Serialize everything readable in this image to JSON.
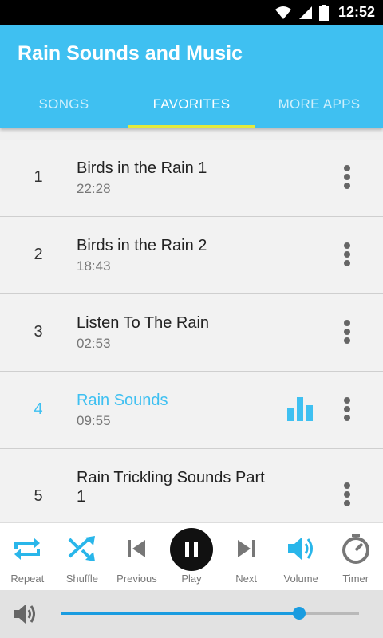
{
  "status_bar": {
    "time": "12:52"
  },
  "app": {
    "title": "Rain Sounds and Music"
  },
  "tabs": [
    {
      "label": "SONGS",
      "active": false
    },
    {
      "label": "FAVORITES",
      "active": true
    },
    {
      "label": "MORE APPS",
      "active": false
    }
  ],
  "songs": [
    {
      "num": "1",
      "name": "Birds in the Rain 1",
      "duration": "22:28"
    },
    {
      "num": "2",
      "name": "Birds in the Rain 2",
      "duration": "18:43"
    },
    {
      "num": "3",
      "name": "Listen To The Rain",
      "duration": "02:53"
    },
    {
      "num": "4",
      "name": "Rain Sounds",
      "duration": "09:55",
      "playing": true
    },
    {
      "num": "5",
      "name": "Rain Trickling Sounds Part 1",
      "duration": ""
    }
  ],
  "player": {
    "repeat_label": "Repeat",
    "shuffle_label": "Shuffle",
    "previous_label": "Previous",
    "play_label": "Play",
    "next_label": "Next",
    "volume_label": "Volume",
    "timer_label": "Timer"
  },
  "volume": {
    "level": 0.8
  },
  "colors": {
    "accent": "#3fc0f1",
    "tab_indicator": "#e3ea3c",
    "slider": "#1a9ce0"
  }
}
